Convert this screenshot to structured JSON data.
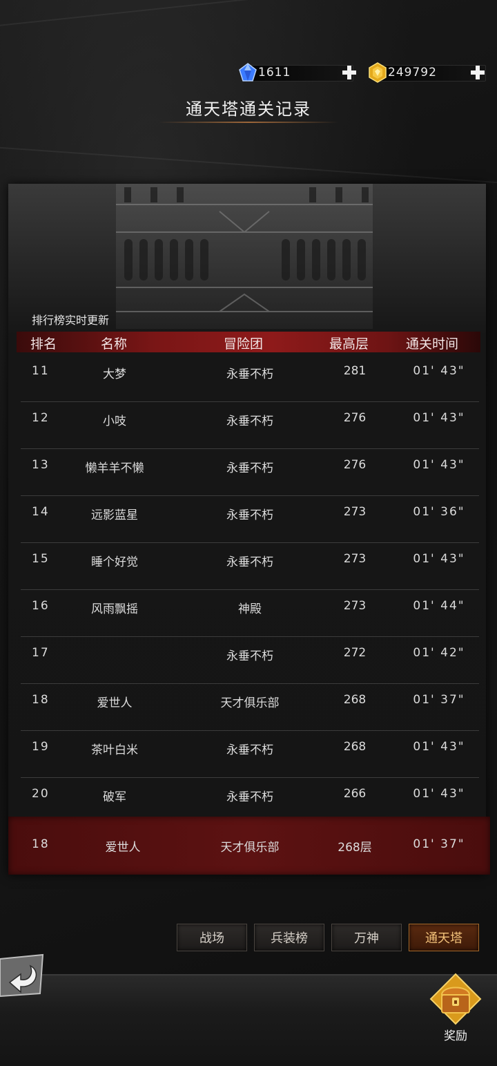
{
  "currencies": {
    "diamond": "1611",
    "gold": "249792"
  },
  "title": "通天塔通关记录",
  "realtime_note": "排行榜实时更新",
  "headers": {
    "rank": "排名",
    "name": "名称",
    "guild": "冒险团",
    "floor": "最高层",
    "time": "通关时间"
  },
  "rows": [
    {
      "rank": "11",
      "name": "大梦",
      "guild": "永垂不朽",
      "floor": "281",
      "time": "01' 43\""
    },
    {
      "rank": "12",
      "name": "小吱",
      "guild": "永垂不朽",
      "floor": "276",
      "time": "01' 43\""
    },
    {
      "rank": "13",
      "name": "懒羊羊不懒",
      "guild": "永垂不朽",
      "floor": "276",
      "time": "01' 43\""
    },
    {
      "rank": "14",
      "name": "远影蓝星",
      "guild": "永垂不朽",
      "floor": "273",
      "time": "01' 36\""
    },
    {
      "rank": "15",
      "name": "睡个好觉",
      "guild": "永垂不朽",
      "floor": "273",
      "time": "01' 43\""
    },
    {
      "rank": "16",
      "name": "风雨飘摇",
      "guild": "神殿",
      "floor": "273",
      "time": "01' 44\""
    },
    {
      "rank": "17",
      "name": "",
      "guild": "永垂不朽",
      "floor": "272",
      "time": "01' 42\""
    },
    {
      "rank": "18",
      "name": "爱世人",
      "guild": "天才俱乐部",
      "floor": "268",
      "time": "01' 37\""
    },
    {
      "rank": "19",
      "name": "茶叶白米",
      "guild": "永垂不朽",
      "floor": "268",
      "time": "01' 43\""
    },
    {
      "rank": "20",
      "name": "破军",
      "guild": "永垂不朽",
      "floor": "266",
      "time": "01' 43\""
    }
  ],
  "my_row": {
    "rank": "18",
    "name": "爱世人",
    "guild": "天才俱乐部",
    "floor": "268层",
    "time": "01' 37\""
  },
  "tabs": [
    "战场",
    "兵装榜",
    "万神",
    "通天塔"
  ],
  "active_tab": "通天塔",
  "reward_label": "奖励",
  "icons": {
    "diamond": "blue-diamond-icon",
    "gold": "gold-coin-icon",
    "plus": "plus-icon",
    "back": "back-arrow-icon",
    "reward": "treasure-chest-icon"
  },
  "colors": {
    "header_red": "#8e1a1a",
    "active_tab_text": "#f3c27a",
    "my_row_red": "#5c1212"
  }
}
